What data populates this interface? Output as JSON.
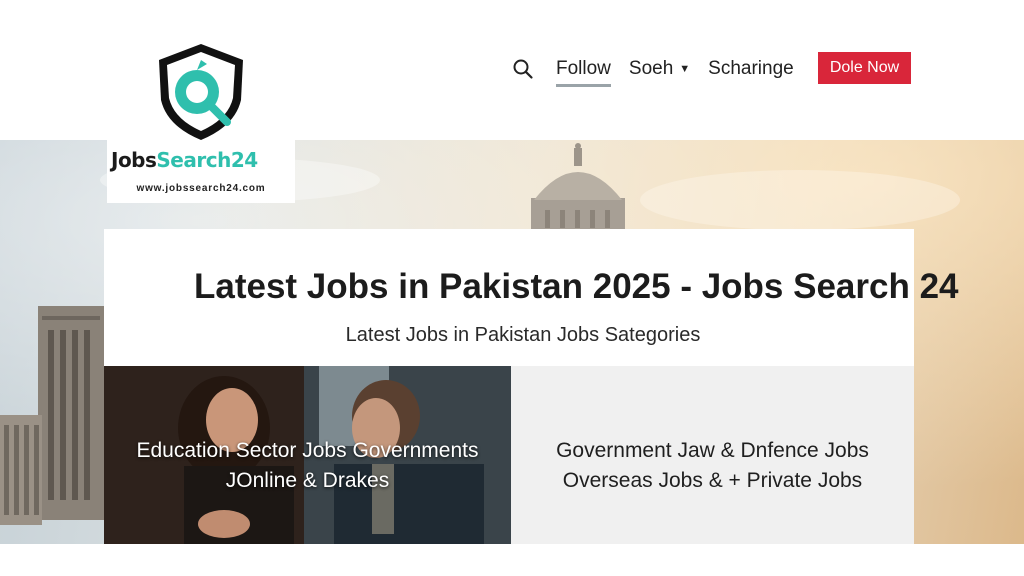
{
  "brand": {
    "name_part1": "Jobs",
    "name_part2": "Search24",
    "url": "www.jobssearch24.com",
    "colors": {
      "teal": "#2fbfad",
      "dark": "#1b1b1b"
    }
  },
  "nav": {
    "search_icon": "search-icon",
    "items": [
      {
        "label": "Follow",
        "active": true
      },
      {
        "label": "Soeh",
        "dropdown": true
      },
      {
        "label": "Scharinge"
      }
    ],
    "cta_label": "Dole Now",
    "cta_color": "#d9263a"
  },
  "hero": {
    "title": "Latest Jobs in Pakistan 2025 - Jobs Search 24",
    "subtitle": "Latest Jobs in Pakistan Jobs Sategories"
  },
  "categories": {
    "left": {
      "line1": "Education Sector Jobs Governments",
      "line2": "JOnline & Drakes"
    },
    "right": {
      "line1": "Government Jaw & Dnfence Jobs",
      "line2": "Overseas Jobs & + Private Jobs"
    }
  }
}
